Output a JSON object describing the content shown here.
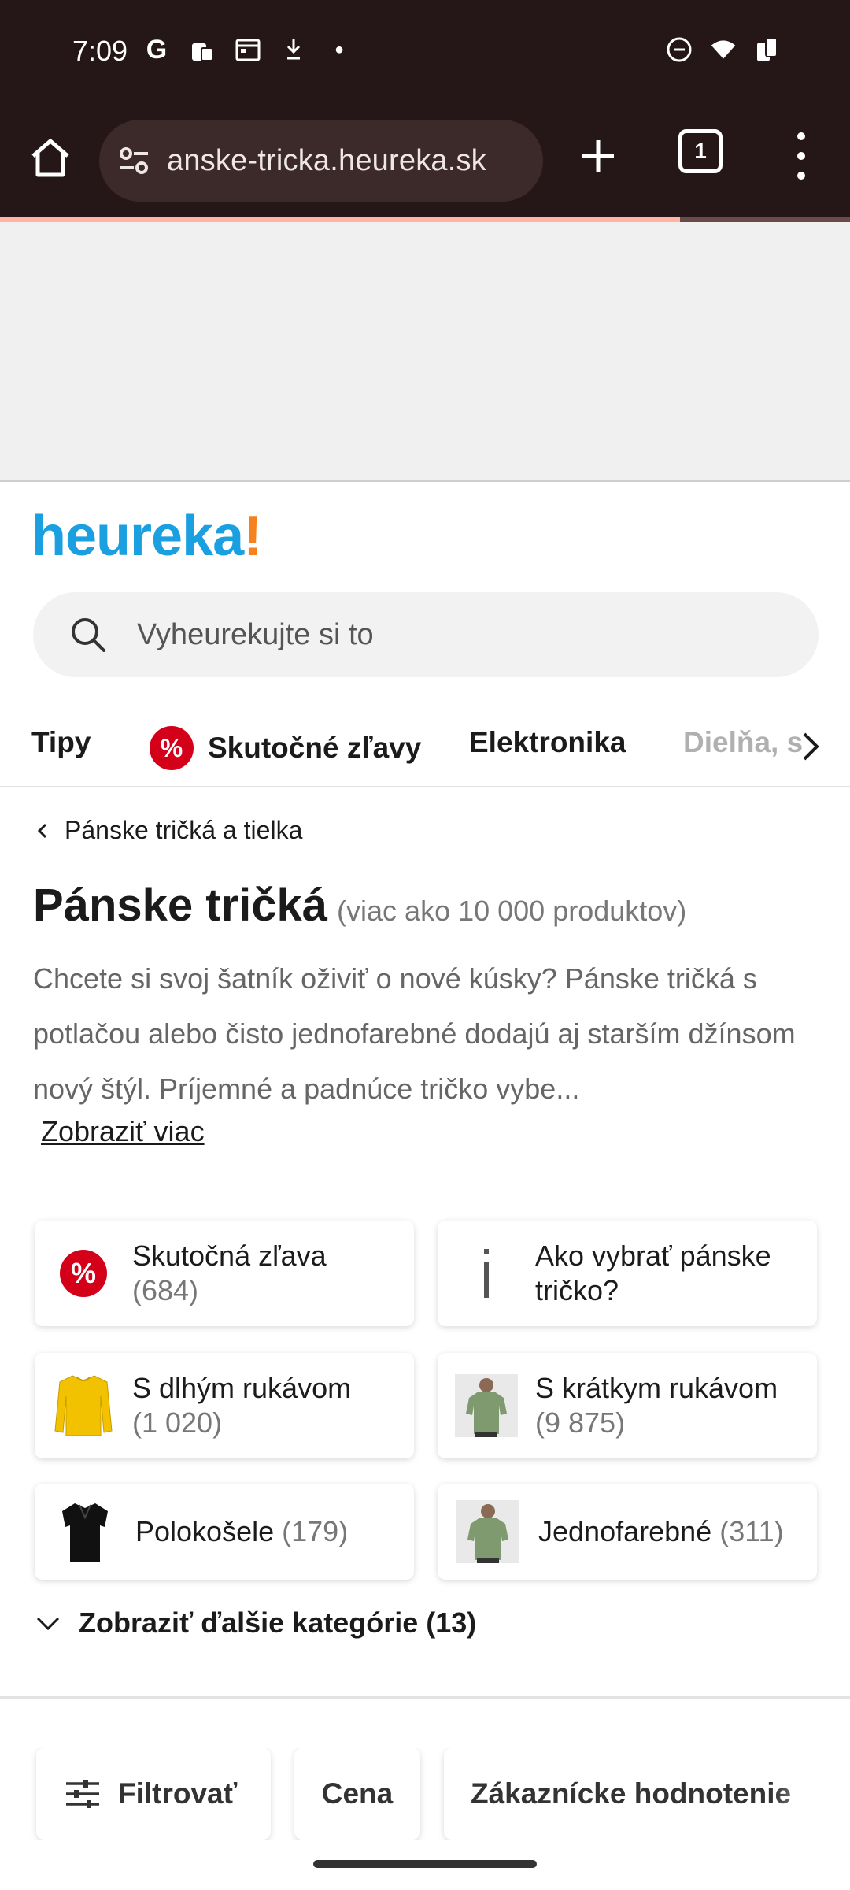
{
  "status_bar": {
    "time": "7:09"
  },
  "browser": {
    "url": "anske-tricka.heureka.sk",
    "tab_count": "1",
    "page_load_progress": 0.8
  },
  "logo": {
    "text": "heureka",
    "bang": "!"
  },
  "search": {
    "placeholder": "Vyheurekujte si to"
  },
  "category_nav": {
    "items": [
      "Tipy",
      "Skutočné zľavy",
      "Elektronika",
      "Dielňa, s"
    ],
    "badge": "%"
  },
  "breadcrumb": {
    "label": "Pánske tričká a tielka"
  },
  "page": {
    "title": "Pánske tričká",
    "product_count": "(viac ako 10 000 produktov)",
    "description": "Chcete si svoj šatník oživiť o nové kúsky? Pánske tričká s potlačou alebo čisto jednofarebné dodajú aj starším džínsom nový štýl. Príjemné a padnúce tričko vybe...",
    "show_more": "Zobraziť viac"
  },
  "categories": [
    {
      "label": "Skutočná zľava",
      "count": "(684)",
      "icon": "percent-icon"
    },
    {
      "label": "Ako vybrať pánske tričko?",
      "count": "",
      "icon": "info-icon"
    },
    {
      "label": "S dlhým rukávom",
      "count": "(1 020)",
      "icon": "yellow-longsleeve-thumb"
    },
    {
      "label": "S krátkym rukávom",
      "count": "(9 875)",
      "icon": "green-tshirt-thumb"
    },
    {
      "label": "Polokošele",
      "count": "(179)",
      "icon": "black-polo-thumb"
    },
    {
      "label": "Jednofarebné",
      "count": "(311)",
      "icon": "green-tshirt-thumb"
    }
  ],
  "more_categories": "Zobraziť ďalšie kategórie (13)",
  "filters": [
    "Filtrovať",
    "Cena",
    "Zákaznícke hodnotenie"
  ],
  "colors": {
    "brand_blue": "#1aa0e0",
    "brand_orange": "#f5821f",
    "discount_red": "#d4001a",
    "chrome_bg": "#251718"
  }
}
